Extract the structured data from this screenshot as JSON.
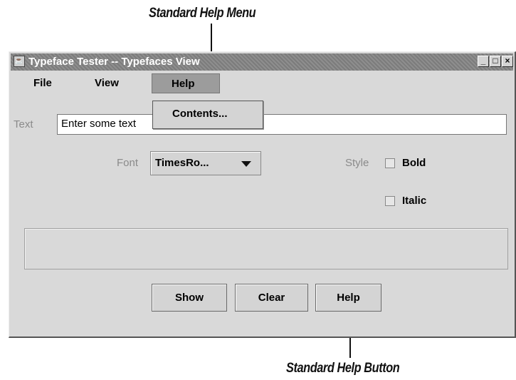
{
  "annotations": {
    "top_callout": "Standard Help Menu",
    "bottom_callout": "Standard Help Button"
  },
  "window": {
    "title": "Typeface Tester -- Typefaces View",
    "icon": "coffee-cup-icon",
    "controls": {
      "minimize": "_",
      "maximize": "□",
      "close": "×"
    }
  },
  "menubar": {
    "items": [
      "File",
      "View",
      "Help"
    ],
    "active_index": 2
  },
  "help_menu": {
    "items": [
      "Contents..."
    ]
  },
  "form": {
    "text_label": "Text",
    "text_value": "Enter some text",
    "font_label": "Font",
    "font_value": "TimesRo...",
    "style_label": "Style",
    "bold_label": "Bold",
    "bold_checked": false,
    "italic_label": "Italic",
    "italic_checked": false
  },
  "buttons": {
    "show": "Show",
    "clear": "Clear",
    "help": "Help"
  }
}
